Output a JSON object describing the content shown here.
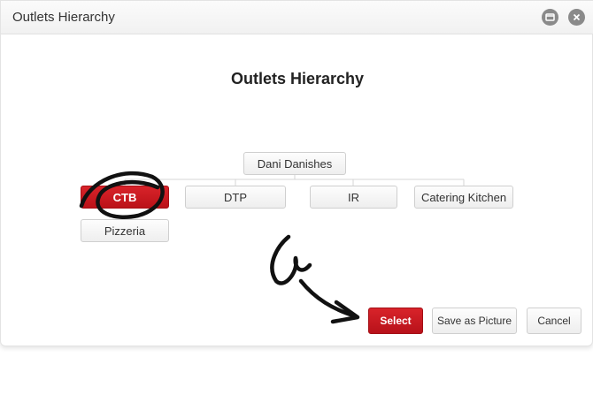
{
  "window": {
    "title": "Outlets Hierarchy",
    "maximize_icon": "maximize-icon",
    "close_icon": "close-icon"
  },
  "heading": "Outlets Hierarchy",
  "tree": {
    "root": "Dani Danishes",
    "children": [
      "CTB",
      "DTP",
      "IR",
      "Catering Kitchen"
    ],
    "selected": "CTB",
    "grandchildren": {
      "CTB": [
        "Pizzeria"
      ]
    }
  },
  "actions": {
    "select_label": "Select",
    "save_picture_label": "Save as Picture",
    "cancel_label": "Cancel"
  },
  "colors": {
    "accent": "#c8181f",
    "annotation_ink": "#111111"
  }
}
